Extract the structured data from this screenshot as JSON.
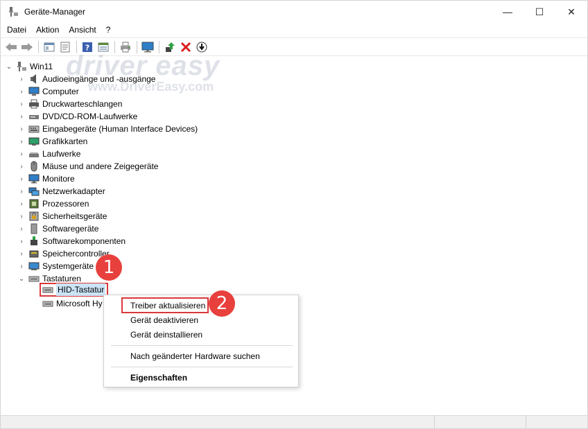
{
  "window": {
    "title": "Geräte-Manager",
    "minimize_glyph": "—",
    "maximize_glyph": "☐",
    "close_glyph": "✕"
  },
  "menu": [
    "Datei",
    "Aktion",
    "Ansicht",
    "?"
  ],
  "toolbar": {
    "icons": [
      "back-arrow-icon",
      "forward-arrow-icon",
      "properties-sheet-icon",
      "driver-details-icon",
      "help-icon",
      "view-icon",
      "print-icon",
      "monitor-icon",
      "update-driver-icon",
      "uninstall-icon",
      "download-icon"
    ]
  },
  "watermark": {
    "brand": "driver easy",
    "url": "www.DriverEasy.com"
  },
  "tree": {
    "root": "Win11",
    "categories": [
      {
        "label": "Audioeingänge und -ausgänge",
        "icon": "speaker-icon"
      },
      {
        "label": "Computer",
        "icon": "computer-icon"
      },
      {
        "label": "Druckwarteschlangen",
        "icon": "printer-icon"
      },
      {
        "label": "DVD/CD-ROM-Laufwerke",
        "icon": "dvd-drive-icon"
      },
      {
        "label": "Eingabegeräte (Human Interface Devices)",
        "icon": "hid-icon"
      },
      {
        "label": "Grafikkarten",
        "icon": "display-adapter-icon"
      },
      {
        "label": "Laufwerke",
        "icon": "disk-drive-icon"
      },
      {
        "label": "Mäuse und andere Zeigegeräte",
        "icon": "mouse-icon"
      },
      {
        "label": "Monitore",
        "icon": "monitor-icon"
      },
      {
        "label": "Netzwerkadapter",
        "icon": "network-adapter-icon"
      },
      {
        "label": "Prozessoren",
        "icon": "processor-icon"
      },
      {
        "label": "Sicherheitsgeräte",
        "icon": "security-device-icon"
      },
      {
        "label": "Softwaregeräte",
        "icon": "software-device-icon"
      },
      {
        "label": "Softwarekomponenten",
        "icon": "software-component-icon"
      },
      {
        "label": "Speichercontroller",
        "icon": "storage-controller-icon"
      },
      {
        "label": "Systemgeräte",
        "icon": "system-device-icon"
      }
    ],
    "expanded_category": "Tastaturen",
    "children": [
      "HID-Tastatur",
      "Microsoft Hy"
    ]
  },
  "context_menu": {
    "items": [
      "Treiber aktualisieren",
      "Gerät deaktivieren",
      "Gerät deinstallieren"
    ],
    "scan": "Nach geänderter Hardware suchen",
    "properties": "Eigenschaften"
  },
  "badges": [
    "1",
    "2"
  ],
  "colors": {
    "highlight_red": "#d9383a",
    "badge_red": "#e8403d",
    "selection_blue": "#cce4f7"
  }
}
